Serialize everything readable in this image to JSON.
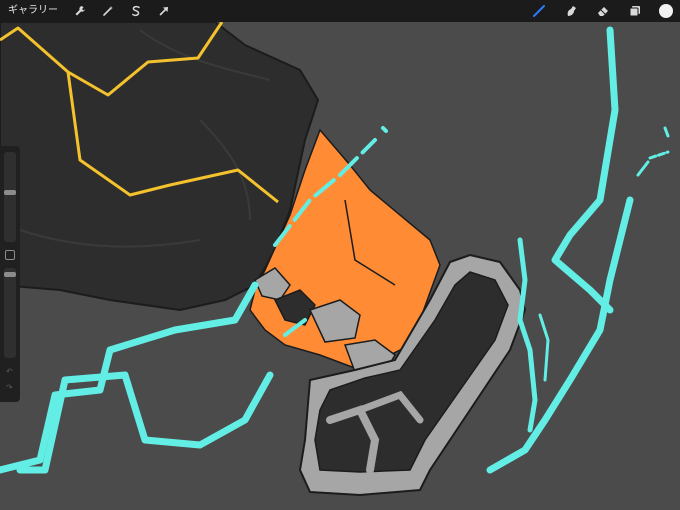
{
  "toolbar": {
    "gallery_label": "ギャラリー",
    "left_tools": [
      {
        "name": "actions",
        "icon": "wrench-icon"
      },
      {
        "name": "adjustments",
        "icon": "magic-wand-icon"
      },
      {
        "name": "selection",
        "icon": "selection-s-icon"
      },
      {
        "name": "transform",
        "icon": "arrow-cursor-icon"
      }
    ],
    "right_tools": [
      {
        "name": "brush",
        "icon": "brush-icon",
        "active": true
      },
      {
        "name": "smudge",
        "icon": "smudge-icon"
      },
      {
        "name": "eraser",
        "icon": "eraser-icon"
      },
      {
        "name": "layers",
        "icon": "layers-icon"
      }
    ],
    "current_color": "#f2f2f2",
    "active_tool_color": "#2b7bff"
  },
  "sidebar": {
    "brush_size_level": 0.55,
    "opacity_level": 0.95
  },
  "artwork": {
    "colors": {
      "background": "#4b4b4b",
      "dark_fabric": "#2d2d2d",
      "orange": "#ff8c35",
      "grey_sandal": "#a6a6a6",
      "cyan_energy": "#63eee5",
      "yellow_outline": "#f4c22c"
    }
  }
}
